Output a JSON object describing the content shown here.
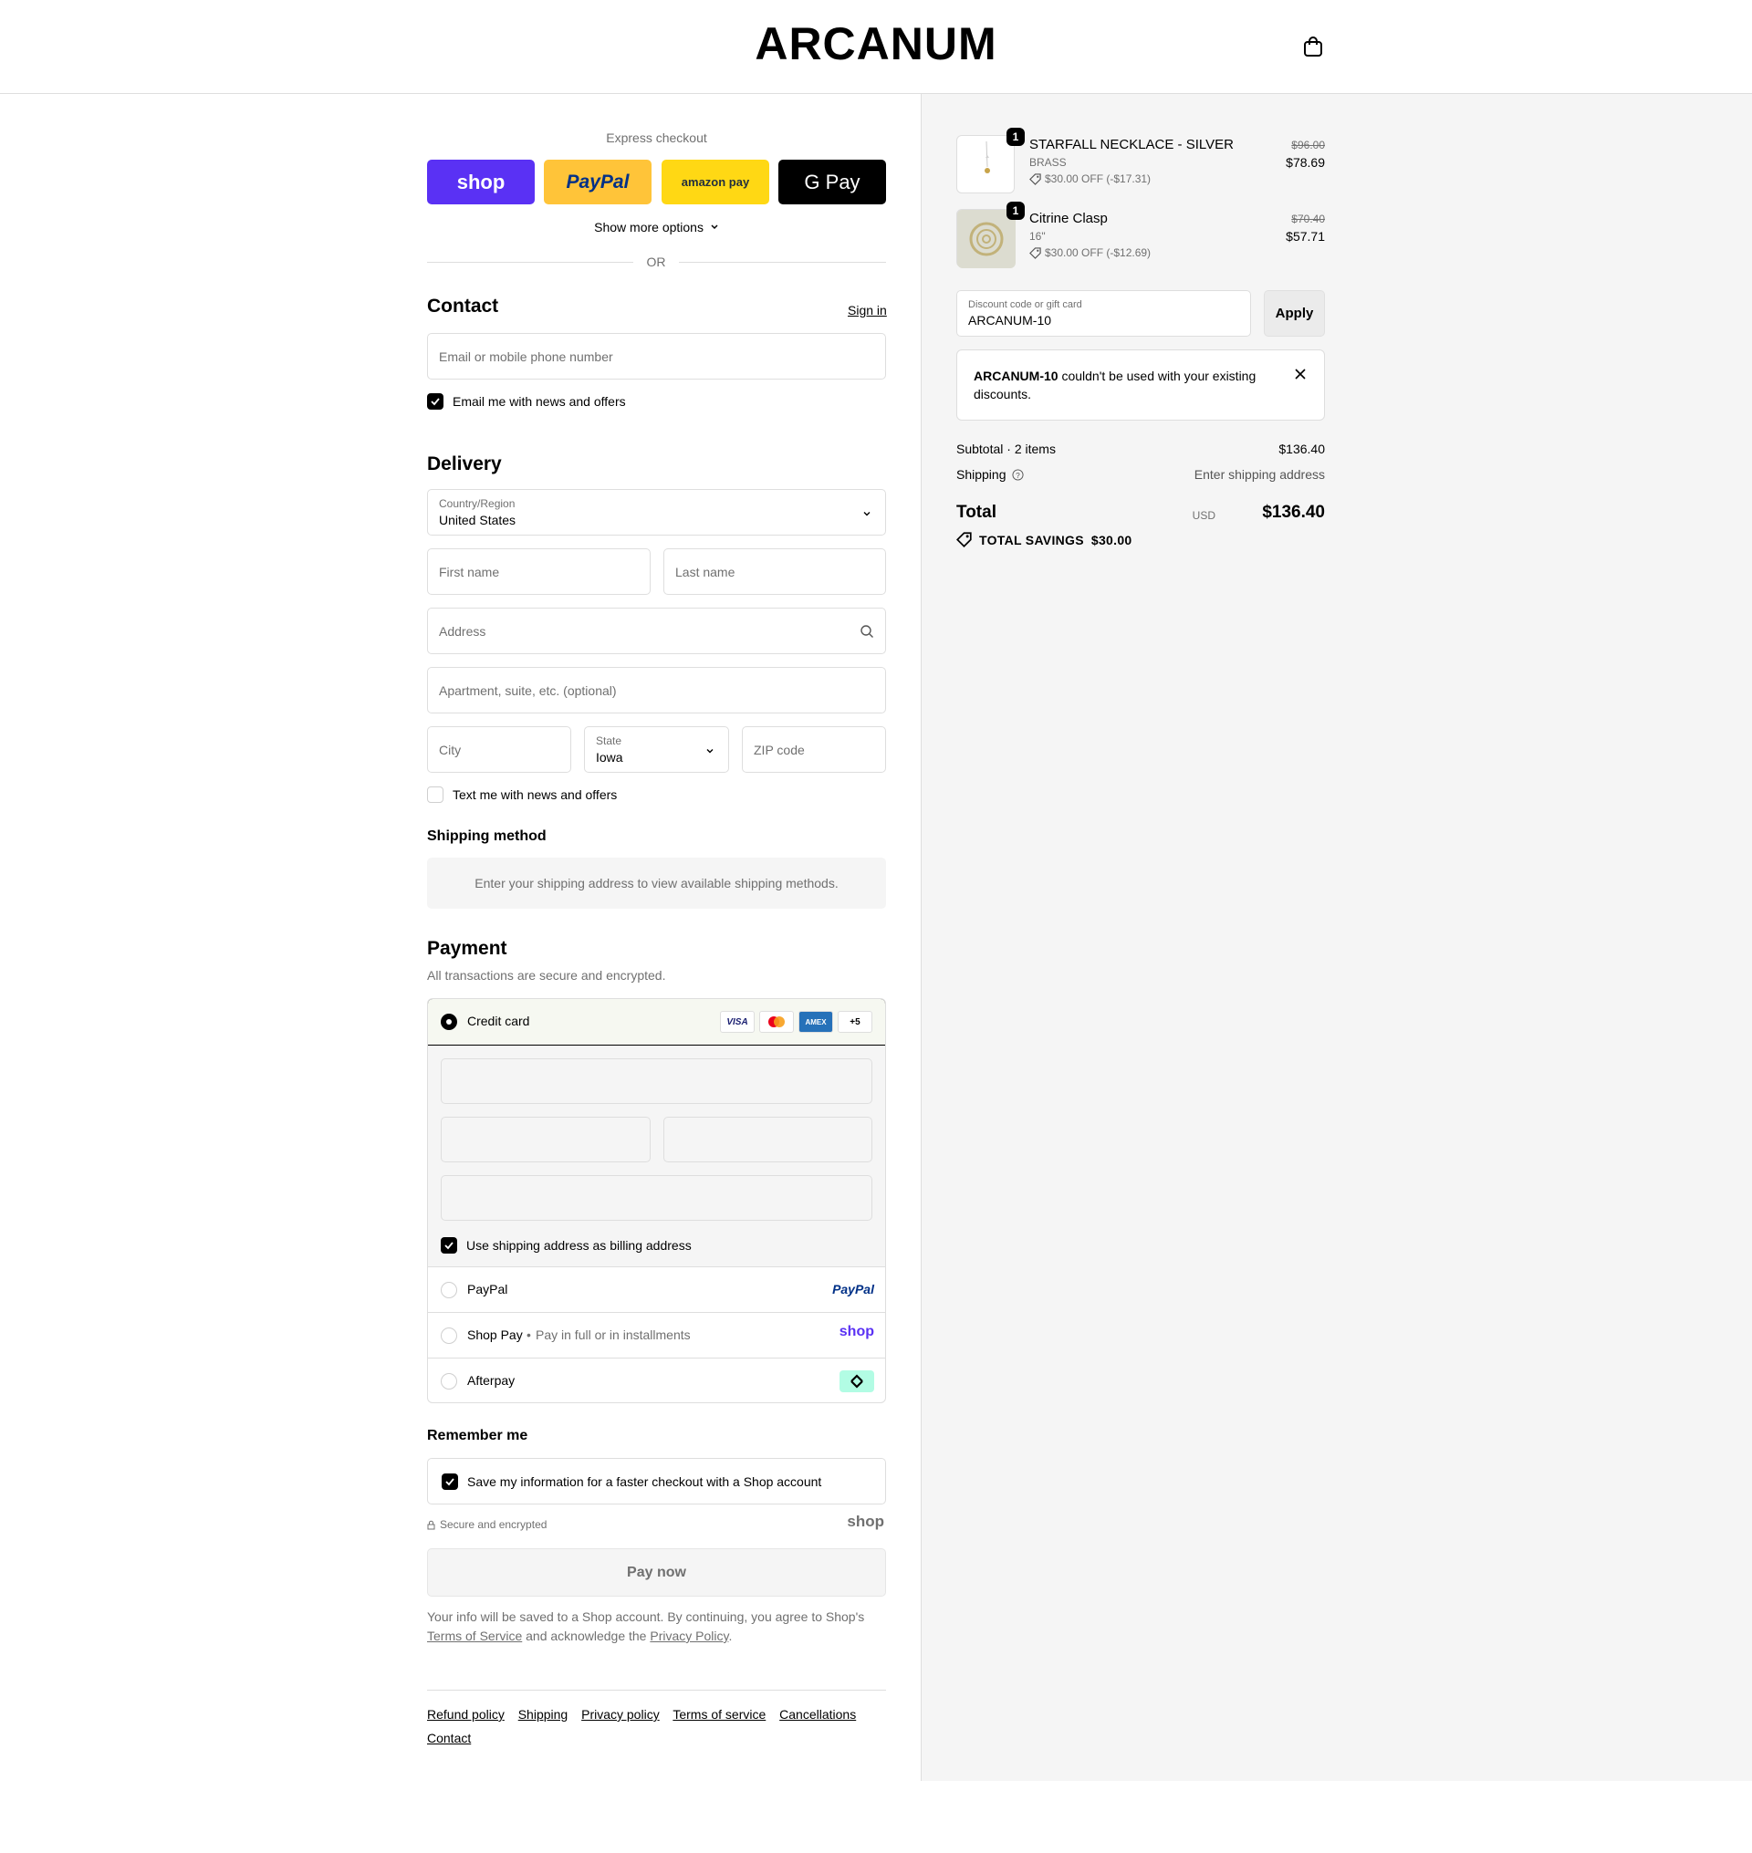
{
  "header": {
    "logo": "ARCANUM",
    "cart_icon": "shopping-bag-icon"
  },
  "express": {
    "title": "Express checkout",
    "buttons": [
      {
        "label": "shop",
        "color": "#5a31f4",
        "text_color": "#ffffff"
      },
      {
        "label": "PayPal",
        "color": "#ffc439",
        "text_color": "#003087"
      },
      {
        "label": "amazon pay",
        "color": "#ffd814",
        "text_color": "#232f3e"
      },
      {
        "label": "G Pay",
        "color": "#000000",
        "text_color": "#ffffff"
      }
    ],
    "show_more": "Show more options",
    "or": "OR"
  },
  "contact": {
    "title": "Contact",
    "sign_in": "Sign in",
    "email_placeholder": "Email or mobile phone number",
    "news_checkbox": "Email me with news and offers",
    "news_checked": true
  },
  "delivery": {
    "title": "Delivery",
    "country_label": "Country/Region",
    "country_value": "United States",
    "first_name_placeholder": "First name",
    "last_name_placeholder": "Last name",
    "address_placeholder": "Address",
    "apartment_placeholder": "Apartment, suite, etc. (optional)",
    "city_placeholder": "City",
    "state_label": "State",
    "state_value": "Iowa",
    "zip_placeholder": "ZIP code",
    "text_checkbox": "Text me with news and offers",
    "text_checked": false
  },
  "shipping_method": {
    "title": "Shipping method",
    "message": "Enter your shipping address to view available shipping methods."
  },
  "payment": {
    "title": "Payment",
    "subtitle": "All transactions are secure and encrypted.",
    "credit_card": {
      "label": "Credit card",
      "selected": true,
      "badges": [
        "VISA",
        "mastercard",
        "AMEX",
        "+5"
      ],
      "billing_checkbox": "Use shipping address as billing address",
      "billing_checked": true
    },
    "paypal": {
      "label": "PayPal",
      "logo": "PayPal"
    },
    "shop_pay": {
      "label": "Shop Pay",
      "sub": "Pay in full or in installments",
      "logo": "shop"
    },
    "afterpay": {
      "label": "Afterpay",
      "logo": "afterpay-icon"
    }
  },
  "remember": {
    "title": "Remember me",
    "checkbox": "Save my information for a faster checkout with a Shop account",
    "checked": true
  },
  "secure_text": "Secure and encrypted",
  "shop_logo": "shop",
  "pay_now": "Pay now",
  "legal": {
    "text_before": "Your info will be saved to a Shop account. By continuing, you agree to Shop's ",
    "terms": "Terms of Service",
    "text_mid": " and acknowledge the ",
    "privacy": "Privacy Policy",
    "text_after": "."
  },
  "footer": {
    "links": [
      "Refund policy",
      "Shipping",
      "Privacy policy",
      "Terms of service",
      "Cancellations",
      "Contact"
    ]
  },
  "summary": {
    "items": [
      {
        "name": "STARFALL NECKLACE - SILVER",
        "variant": "BRASS",
        "discount": "$30.00 OFF (-$17.31)",
        "price_old": "$96.00",
        "price_new": "$78.69",
        "qty": "1"
      },
      {
        "name": "Citrine Clasp",
        "variant": "16\"",
        "discount": "$30.00 OFF (-$12.69)",
        "price_old": "$70.40",
        "price_new": "$57.71",
        "qty": "1"
      }
    ],
    "discount_label": "Discount code or gift card",
    "discount_value": "ARCANUM-10",
    "apply": "Apply",
    "error_code": "ARCANUM-10",
    "error_text": " couldn't be used with your existing discounts.",
    "subtotal_label": "Subtotal · 2 items",
    "subtotal_value": "$136.40",
    "shipping_label": "Shipping",
    "shipping_value": "Enter shipping address",
    "total_label": "Total",
    "currency": "USD",
    "total_value": "$136.40",
    "savings_label": "TOTAL SAVINGS",
    "savings_value": "$30.00"
  }
}
